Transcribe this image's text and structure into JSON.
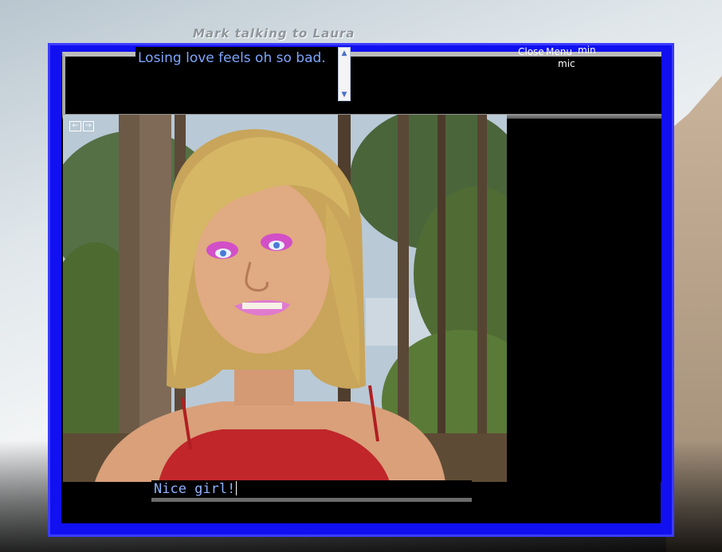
{
  "window": {
    "title": "Mark talking to Laura"
  },
  "message": {
    "text": "Losing love feels oh so bad."
  },
  "controls": {
    "close": "Close",
    "menu": "Menu",
    "min": "min",
    "mic": "mic"
  },
  "chat_input": {
    "value": "Nice girl!"
  },
  "nav": {
    "left_icon": "arrow-left-icon",
    "right_icon": "arrow-right-icon"
  },
  "colors": {
    "frame_blue": "#1010f0",
    "text_blue": "#7ea6ff"
  }
}
